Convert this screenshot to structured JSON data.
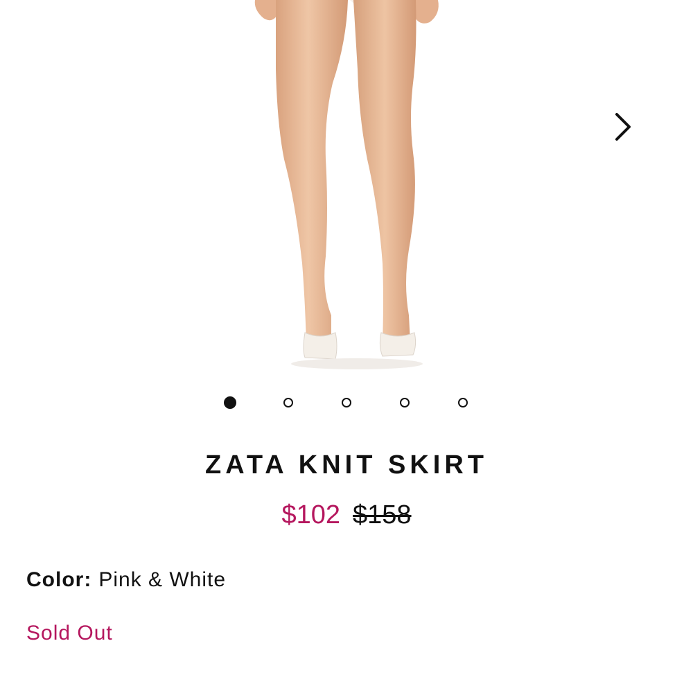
{
  "carousel": {
    "image_alt": "",
    "next_icon": "chevron-right-icon",
    "total_slides": 5,
    "active_index": 0
  },
  "product": {
    "name": "ZATA KNIT SKIRT",
    "sale_price": "$102",
    "original_price": "$158",
    "color_label": "Color:",
    "color_value": "Pink & White",
    "availability": "Sold Out"
  },
  "colors": {
    "accent": "#b5175e",
    "text": "#111111",
    "background": "#ffffff",
    "skin": "#e6b592",
    "shoe": "#f4efe8"
  }
}
